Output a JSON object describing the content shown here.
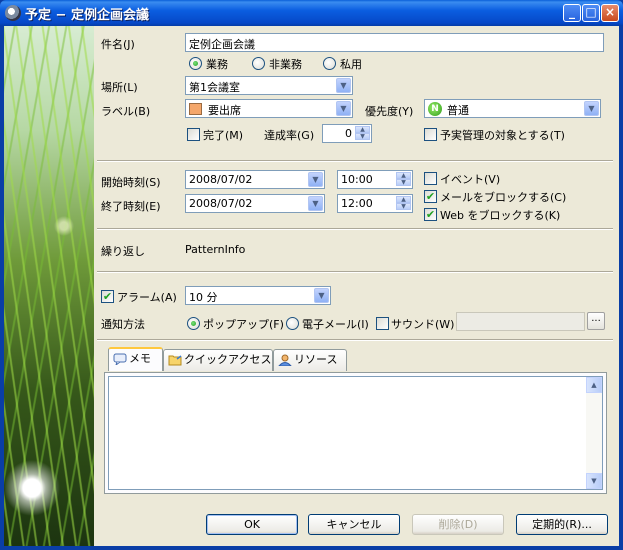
{
  "window": {
    "title": "予定 − 定例企画会議",
    "minimize_glyph": "_",
    "maximize_glyph": "□",
    "close_glyph": "×"
  },
  "subject": {
    "label": "件名(J)",
    "value": "定例企画会議"
  },
  "category_radios": [
    {
      "label": "業務",
      "checked": true
    },
    {
      "label": "非業務",
      "checked": false
    },
    {
      "label": "私用",
      "checked": false
    }
  ],
  "location": {
    "label": "場所(L)",
    "value": "第1会議室"
  },
  "label_field": {
    "label": "ラベル(B)",
    "value": "要出席",
    "color": "#f4a66a"
  },
  "priority": {
    "label": "優先度(Y)",
    "value": "普通",
    "icon_text": "N"
  },
  "complete": {
    "label": "完了(M)",
    "checked": false
  },
  "achievement": {
    "label": "達成率(G)",
    "value": "0"
  },
  "plan_actual": {
    "label": "予実管理の対象とする(T)",
    "checked": false
  },
  "start": {
    "label": "開始時刻(S)",
    "date": "2008/07/02",
    "time": "10:00"
  },
  "end": {
    "label": "終了時刻(E)",
    "date": "2008/07/02",
    "time": "12:00"
  },
  "event_check": {
    "label": "イベント(V)",
    "checked": false
  },
  "block_mail": {
    "label": "メールをブロックする(C)",
    "checked": true
  },
  "block_web": {
    "label": "Web をブロックする(K)",
    "checked": true
  },
  "repeat": {
    "label": "繰り返し",
    "value": "PatternInfo"
  },
  "alarm": {
    "label": "アラーム(A)",
    "checked": true,
    "value": "10 分"
  },
  "notify": {
    "label": "通知方法",
    "popup": {
      "label": "ポップアップ(F)",
      "checked": true
    },
    "email": {
      "label": "電子メール(I)",
      "checked": false
    },
    "sound": {
      "label": "サウンド(W)",
      "checked": false
    },
    "sound_path": "",
    "browse_label": "..."
  },
  "tabs": [
    {
      "label": "メモ",
      "active": true,
      "icon": "memo-icon"
    },
    {
      "label": "クイックアクセス",
      "active": false,
      "icon": "folder-icon"
    },
    {
      "label": "リソース",
      "active": false,
      "icon": "person-icon"
    }
  ],
  "memo_text": "",
  "buttons": {
    "ok": "OK",
    "cancel": "キャンセル",
    "delete": "削除(D)",
    "recurring": "定期的(R)..."
  }
}
